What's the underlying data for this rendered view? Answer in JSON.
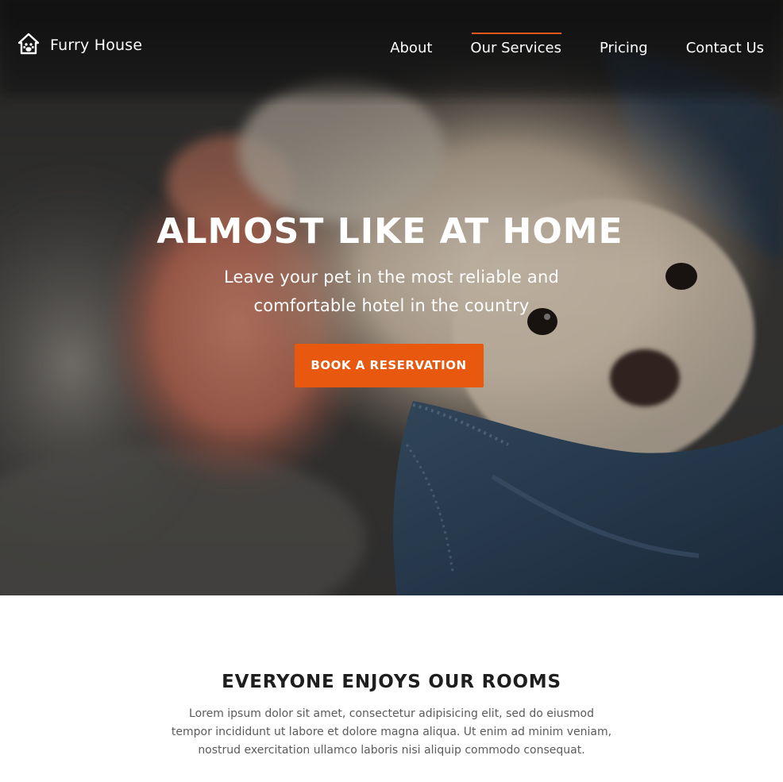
{
  "brand": {
    "name": "Furry House",
    "icon": "house-paw-icon"
  },
  "nav": {
    "items": [
      {
        "label": "About",
        "active": false
      },
      {
        "label": "Our Services",
        "active": true
      },
      {
        "label": "Pricing",
        "active": false
      },
      {
        "label": "Contact Us",
        "active": false
      }
    ]
  },
  "hero": {
    "title": "ALMOST LIKE AT HOME",
    "subtitle_line1": "Leave your pet in the most reliable and",
    "subtitle_line2": "comfortable hotel in the country",
    "cta_label": "BOOK A RESERVATION"
  },
  "rooms": {
    "title": "EVERYONE ENJOYS OUR ROOMS",
    "text_line1": "Lorem ipsum dolor sit amet, consectetur adipisicing elit, sed do eiusmod",
    "text_line2": "tempor incididunt ut labore et dolore magna aliqua. Ut enim ad minim veniam,",
    "text_line3": "nostrud exercitation ullamco laboris nisi aliquip commodo consequat."
  },
  "colors": {
    "accent": "#e8580f",
    "nav_underline": "#e8581a",
    "heading": "#1e1e1e",
    "body_text": "#5b5b5b"
  }
}
